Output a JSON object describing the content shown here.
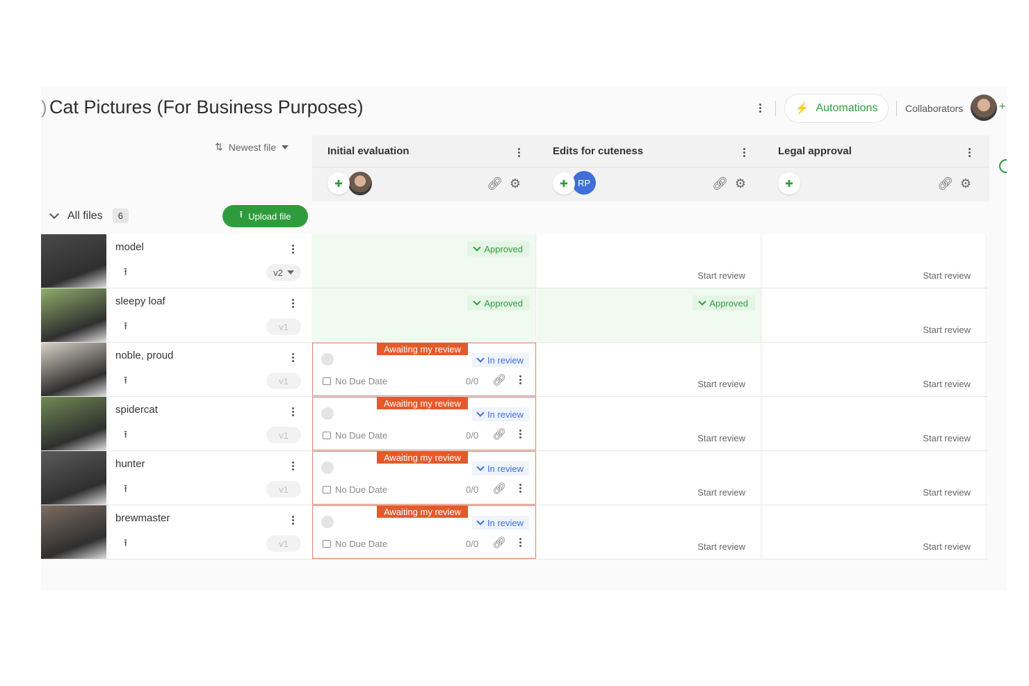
{
  "header": {
    "title": "Cat Pictures (For Business Purposes)",
    "automations_label": "Automations",
    "collaborators_label": "Collaborators",
    "collaborators_add": "+"
  },
  "toolbar": {
    "sort_label": "Newest file",
    "group_label": "All files",
    "file_count": "6",
    "upload_label": "Upload file"
  },
  "stages": [
    {
      "name": "Initial evaluation",
      "assignee": "photo"
    },
    {
      "name": "Edits for cuteness",
      "assignee": "RP"
    },
    {
      "name": "Legal approval",
      "assignee": ""
    }
  ],
  "labels": {
    "start_review": "Start review",
    "approved": "Approved",
    "awaiting": "Awaiting my review",
    "in_review": "In review",
    "no_due_date": "No Due Date",
    "progress": "0/0"
  },
  "files": [
    {
      "name": "model",
      "version": "v2",
      "stage_states": [
        "approved",
        "start",
        "start"
      ]
    },
    {
      "name": "sleepy loaf",
      "version": "v1",
      "stage_states": [
        "approved",
        "approved",
        "start"
      ]
    },
    {
      "name": "noble, proud",
      "version": "v1",
      "stage_states": [
        "in_review",
        "start",
        "start"
      ]
    },
    {
      "name": "spidercat",
      "version": "v1",
      "stage_states": [
        "in_review",
        "start",
        "start"
      ]
    },
    {
      "name": "hunter",
      "version": "v1",
      "stage_states": [
        "in_review",
        "start",
        "start"
      ]
    },
    {
      "name": "brewmaster",
      "version": "v1",
      "stage_states": [
        "in_review",
        "start",
        "start"
      ]
    }
  ],
  "colors": {
    "brand_green": "#2e9c3c",
    "awaiting_orange": "#e45a2b",
    "in_review_blue": "#3f6fd8",
    "approved_bg": "#f0faf0"
  }
}
